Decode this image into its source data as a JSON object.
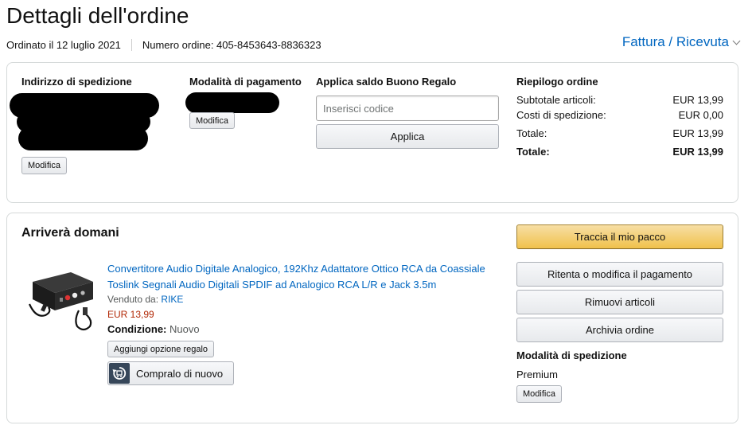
{
  "header": {
    "title": "Dettagli dell'ordine",
    "ordered_on": "Ordinato il 12 luglio 2021",
    "order_number": "Numero ordine: 405-8453643-8836323",
    "invoice_link": "Fattura / Ricevuta"
  },
  "summary_box": {
    "shipping_address": {
      "heading": "Indirizzo di spedizione",
      "edit_label": "Modifica"
    },
    "payment_method": {
      "heading": "Modalità di pagamento",
      "edit_label": "Modifica"
    },
    "gift_card": {
      "heading": "Applica saldo Buono Regalo",
      "placeholder": "Inserisci codice",
      "apply_label": "Applica"
    },
    "order_summary": {
      "heading": "Riepilogo ordine",
      "rows": [
        {
          "label": "Subtotale articoli:",
          "value": "EUR 13,99"
        },
        {
          "label": "Costi di spedizione:",
          "value": "EUR 0,00"
        },
        {
          "label": "Totale:",
          "value": "EUR 13,99"
        },
        {
          "label": "Totale:",
          "value": "EUR 13,99"
        }
      ]
    }
  },
  "shipment": {
    "status": "Arriverà domani",
    "product": {
      "title": "Convertitore Audio Digitale Analogico, 192Khz Adattatore Ottico RCA da Coassiale Toslink Segnali Audio Digitali SPDIF ad Analogico RCA L/R e Jack 3.5m",
      "sold_by_label": "Venduto da:",
      "seller": "RIKE",
      "price": "EUR 13,99",
      "condition_label": "Condizione:",
      "condition_value": "Nuovo",
      "gift_option_label": "Aggiungi opzione regalo",
      "buy_again_label": "Compralo di nuovo"
    },
    "actions": {
      "track": "Traccia il mio pacco",
      "retry_payment": "Ritenta o modifica il pagamento",
      "remove_items": "Rimuovi articoli",
      "archive": "Archivia ordine"
    },
    "shipping_method": {
      "heading": "Modalità di spedizione",
      "value": "Premium",
      "edit_label": "Modifica"
    }
  },
  "colors": {
    "link": "#0066c0",
    "price": "#b12704",
    "track_button": "#f0c14b"
  }
}
